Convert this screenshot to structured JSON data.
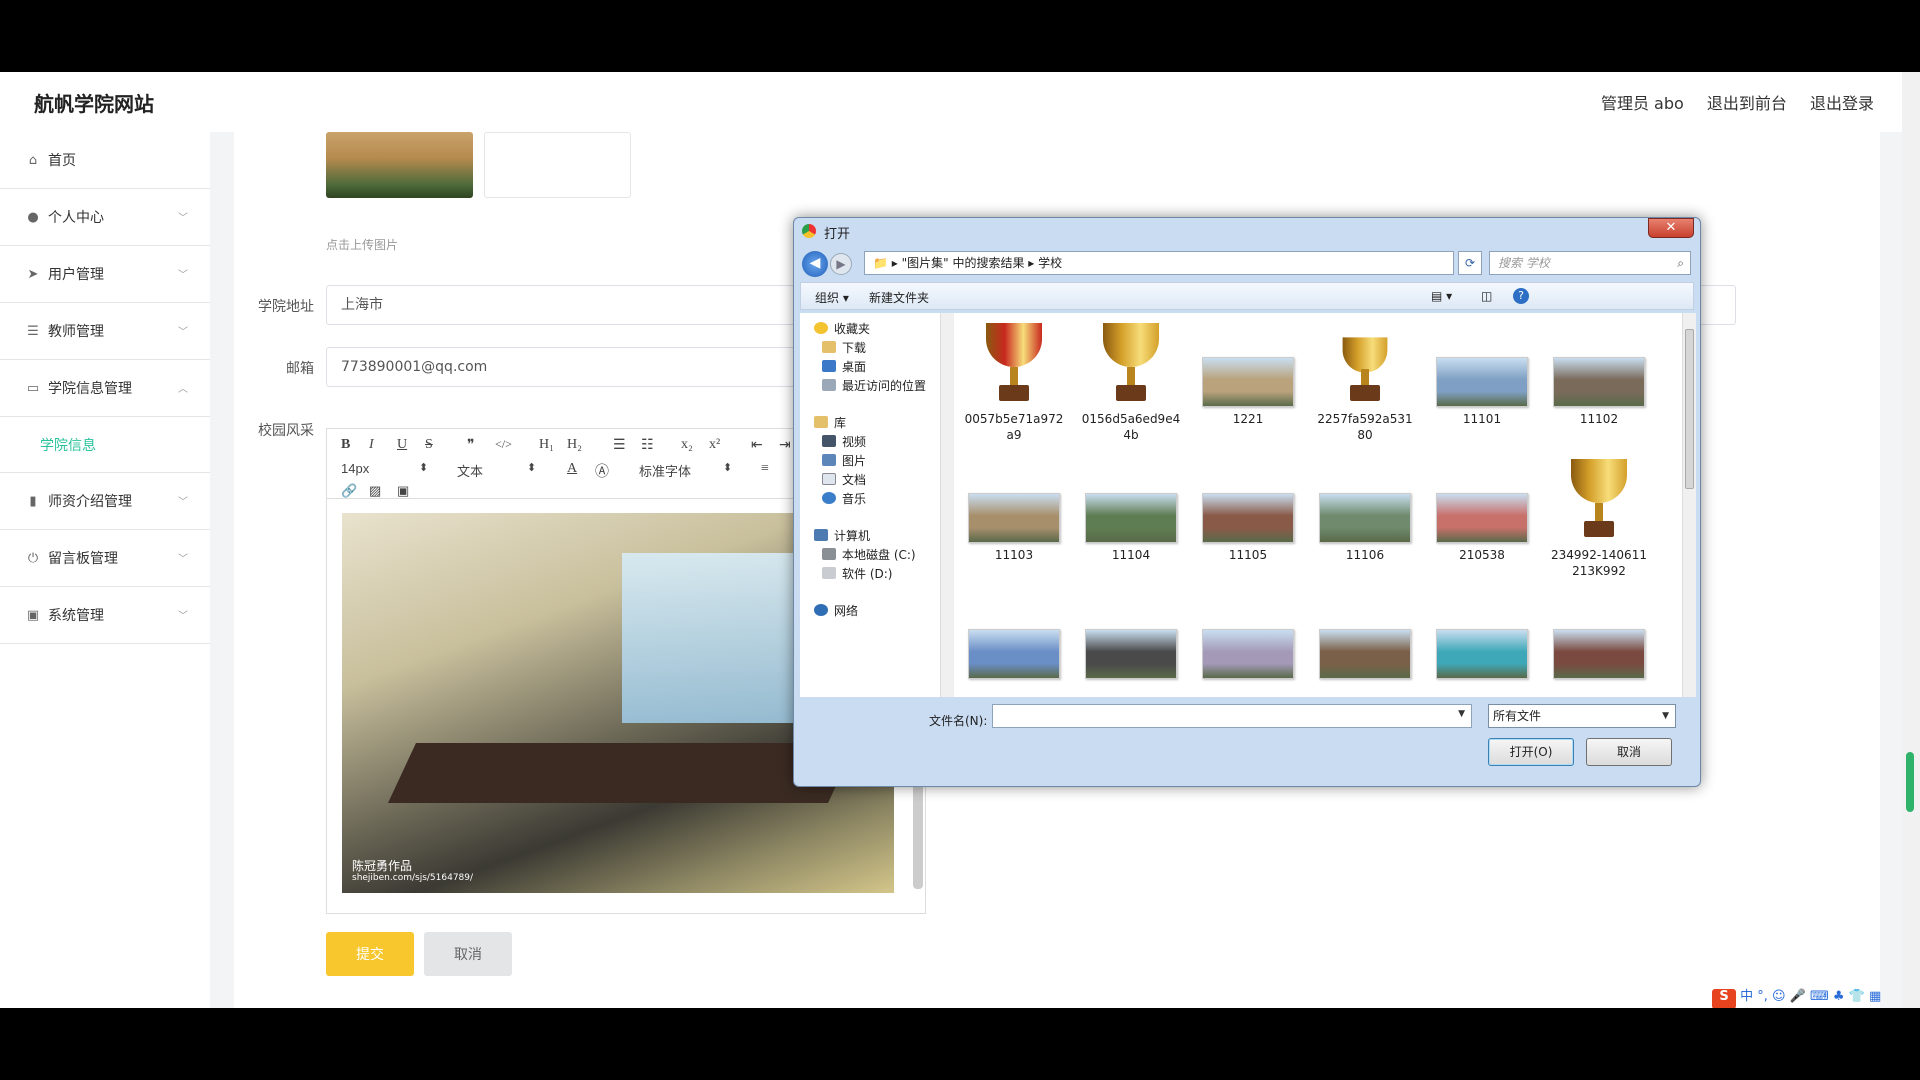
{
  "site": {
    "brand": "航帆学院网站",
    "admin": "管理员 abo",
    "to_front": "退出到前台",
    "logout": "退出登录"
  },
  "sidebar": {
    "items": [
      {
        "label": "首页",
        "icon": "home-icon"
      },
      {
        "label": "个人中心",
        "icon": "user-icon"
      },
      {
        "label": "用户管理",
        "icon": "send-icon"
      },
      {
        "label": "教师管理",
        "icon": "sliders-icon"
      },
      {
        "label": "学院信息管理",
        "icon": "message-icon"
      },
      {
        "label": "学院信息",
        "icon": ""
      },
      {
        "label": "师资介绍管理",
        "icon": "chart-icon"
      },
      {
        "label": "留言板管理",
        "icon": "power-icon"
      },
      {
        "label": "系统管理",
        "icon": "card-icon"
      }
    ]
  },
  "form": {
    "upload_hint": "点击上传图片",
    "address_label": "学院地址",
    "address_value": "上海市",
    "email_label": "邮箱",
    "email_value": "773890001@qq.com",
    "campus_label": "校园风采",
    "submit": "提交",
    "cancel": "取消"
  },
  "editor": {
    "font_size": "14px",
    "paragraph": "文本",
    "font_family": "标准字体",
    "photo_caption": "陈冠勇作品",
    "photo_url": "shejiben.com/sjs/5164789/"
  },
  "dialog": {
    "title": "打开",
    "path_root": "\"图片集\" 中的搜索结果",
    "path_leaf": "学校",
    "search_placeholder": "搜索 学校",
    "organize": "组织 ▾",
    "new_folder": "新建文件夹",
    "tree": {
      "favorites": "收藏夹",
      "downloads": "下载",
      "desktop": "桌面",
      "recent": "最近访问的位置",
      "library": "库",
      "videos": "视频",
      "pictures": "图片",
      "documents": "文档",
      "music": "音乐",
      "computer": "计算机",
      "disk_c": "本地磁盘 (C:)",
      "disk_d": "软件 (D:)",
      "network": "网络"
    },
    "files": [
      {
        "name": "0057b5e71a972\na9",
        "kind": "trophy-red"
      },
      {
        "name": "0156d5a6ed9e4\n4b",
        "kind": "trophy-gold"
      },
      {
        "name": "1221",
        "kind": "photo",
        "color": "#b9a27c"
      },
      {
        "name": "2257fa592a531\n80",
        "kind": "trophy-gold-small"
      },
      {
        "name": "11101",
        "kind": "photo",
        "color": "#7fa0c4"
      },
      {
        "name": "11102",
        "kind": "photo",
        "color": "#7a6a5a"
      },
      {
        "name": "11103",
        "kind": "photo",
        "color": "#a88f6c"
      },
      {
        "name": "11104",
        "kind": "photo",
        "color": "#5f7d52"
      },
      {
        "name": "11105",
        "kind": "photo",
        "color": "#8a5a48"
      },
      {
        "name": "11106",
        "kind": "photo",
        "color": "#6f8a6c"
      },
      {
        "name": "210538",
        "kind": "photo",
        "color": "#c8706a"
      },
      {
        "name": "234992-140611\n213K992",
        "kind": "trophy-laurel"
      },
      {
        "name": "",
        "kind": "photo",
        "color": "#6a8ec6"
      },
      {
        "name": "",
        "kind": "photo",
        "color": "#4a4a4a"
      },
      {
        "name": "",
        "kind": "photo",
        "color": "#a49ab8"
      },
      {
        "name": "",
        "kind": "photo",
        "color": "#7a6048"
      },
      {
        "name": "",
        "kind": "photo",
        "color": "#3fa8b8"
      },
      {
        "name": "",
        "kind": "photo",
        "color": "#7a4a40"
      }
    ],
    "filename_label": "文件名(N):",
    "filename_value": "",
    "filetype": "所有文件",
    "open_btn": "打开(O)",
    "cancel_btn": "取消"
  },
  "ime": {
    "logo": "S",
    "text": "中 °, ☺ 🎤 ⌨ ♣ 👕 ▦"
  }
}
